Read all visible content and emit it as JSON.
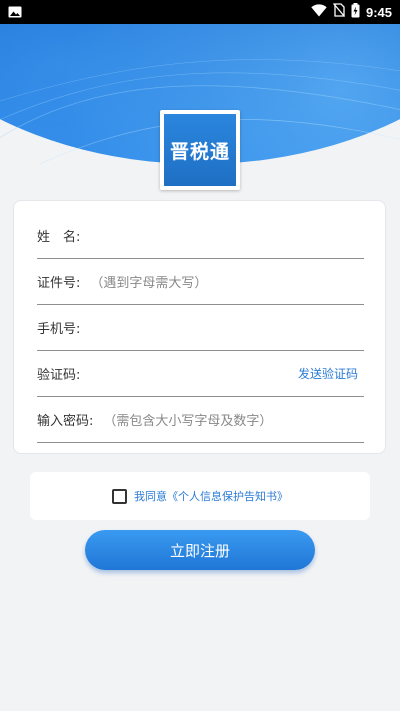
{
  "status_bar": {
    "time": "9:45",
    "icons": [
      "image-icon",
      "wifi-icon",
      "no-sim-icon",
      "battery-charging-icon"
    ]
  },
  "app": {
    "logo_text": "晋税通"
  },
  "form": {
    "name_label": "姓　名:",
    "id_label": "证件号:",
    "id_hint": "（遇到字母需大写）",
    "phone_label": "手机号:",
    "code_label": "验证码:",
    "send_code": "发送验证码",
    "password_label": "输入密码:",
    "password_hint": "（需包含大小写字母及数字）"
  },
  "agreement": {
    "checked": false,
    "text": "我同意《个人信息保护告知书》"
  },
  "register_button": "立即注册",
  "colors": {
    "accent": "#2b7bd6",
    "button": "#1f76d6",
    "background": "#f2f3f5"
  }
}
